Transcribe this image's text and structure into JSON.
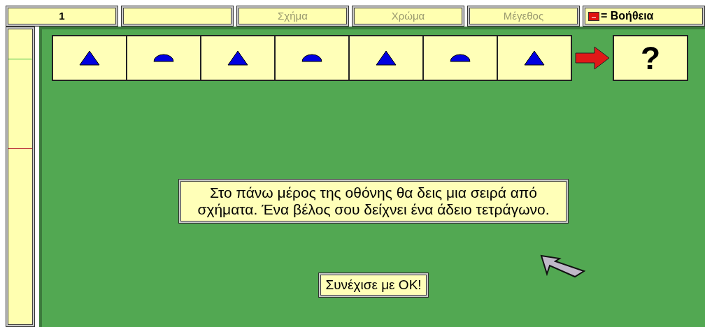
{
  "round": "1",
  "categories": [
    {
      "label": "Σχήμα",
      "disabled": true
    },
    {
      "label": "Χρώμα",
      "disabled": true
    },
    {
      "label": "Μέγεθος",
      "disabled": true
    }
  ],
  "help": {
    "label": "= Βοήθεια"
  },
  "sequence": [
    {
      "kind": "triangle"
    },
    {
      "kind": "semicircle"
    },
    {
      "kind": "triangle"
    },
    {
      "kind": "semicircle"
    },
    {
      "kind": "triangle"
    },
    {
      "kind": "semicircle"
    },
    {
      "kind": "triangle"
    }
  ],
  "answer": {
    "label": "?"
  },
  "message": "Στο πάνω μέρος της οθόνης θα δεις μια σειρά από σχήματα. Ένα βέλος σου δείχνει ένα άδειο τετράγωνο.",
  "continue_button": "Συνέχισε με ΟΚ!"
}
